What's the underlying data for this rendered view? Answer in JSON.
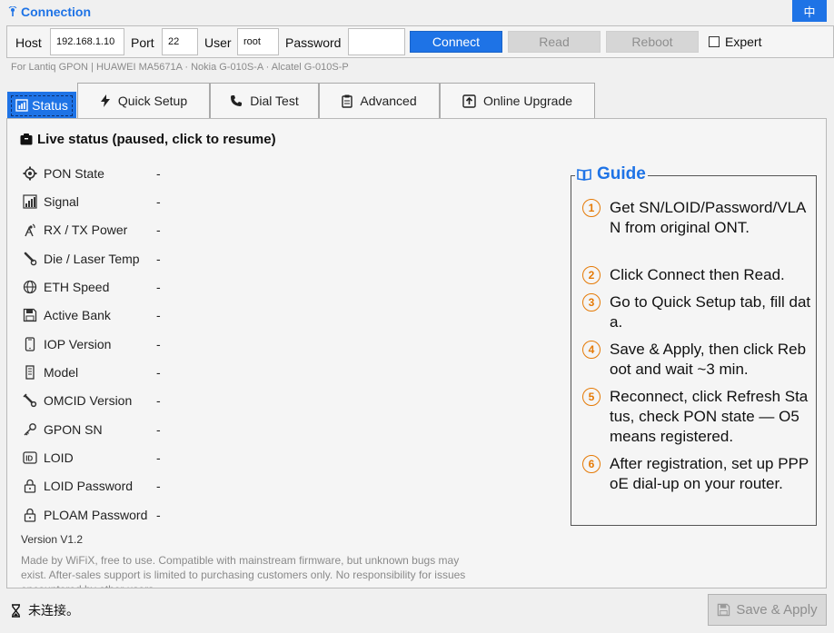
{
  "connection": {
    "title": "Connection",
    "lang_button": "中",
    "host_label": "Host",
    "host_value": "192.168.1.10",
    "port_label": "Port",
    "port_value": "22",
    "user_label": "User",
    "user_value": "root",
    "password_label": "Password",
    "password_value": "",
    "connect_label": "Connect",
    "read_label": "Read",
    "reboot_label": "Reboot",
    "expert_label": "Expert",
    "expert_checked": false,
    "hint": "For Lantiq GPON | HUAWEI MA5671A · Nokia G-010S-A · Alcatel G-010S-P"
  },
  "tabs": [
    {
      "label": "Status",
      "icon": "status-icon",
      "active": true
    },
    {
      "label": "Quick Setup",
      "icon": "lightning-icon"
    },
    {
      "label": "Dial Test",
      "icon": "phone-icon"
    },
    {
      "label": "Advanced",
      "icon": "clipboard-icon"
    },
    {
      "label": "Online Upgrade",
      "icon": "upload-icon"
    }
  ],
  "status": {
    "live_label": "Live status (paused, click to resume)",
    "items": [
      {
        "label": "PON State",
        "value": "-",
        "icon": "gear-icon"
      },
      {
        "label": "Signal",
        "value": "-",
        "icon": "signal-icon"
      },
      {
        "label": "RX / TX Power",
        "value": "-",
        "icon": "antenna-icon"
      },
      {
        "label": "Die / Laser Temp",
        "value": "-",
        "icon": "thermometer-icon"
      },
      {
        "label": "ETH Speed",
        "value": "-",
        "icon": "globe-icon"
      },
      {
        "label": "Active Bank",
        "value": "-",
        "icon": "floppy-icon"
      },
      {
        "label": "IOP Version",
        "value": "-",
        "icon": "phone-device-icon"
      },
      {
        "label": "Model",
        "value": "-",
        "icon": "device-icon"
      },
      {
        "label": "OMCID Version",
        "value": "-",
        "icon": "wrench-icon"
      },
      {
        "label": "GPON SN",
        "value": "-",
        "icon": "key-icon"
      },
      {
        "label": "LOID",
        "value": "-",
        "icon": "id-icon"
      },
      {
        "label": "LOID Password",
        "value": "-",
        "icon": "lock-icon"
      },
      {
        "label": "PLOAM Password",
        "value": "-",
        "icon": "lock-icon"
      }
    ],
    "version": "Version V1.2",
    "made_by": "Made by WiFiX, free to use. Compatible with mainstream firmware, but unknown bugs may exist. After-sales support is limited to purchasing customers only. No responsibility for issues encountered by other users."
  },
  "guide": {
    "title": "Guide",
    "steps": [
      {
        "num": "1",
        "text": "Get SN/LOID/Password/VLAN from original ONT."
      },
      {
        "num": "2",
        "text": "Click Connect then Read."
      },
      {
        "num": "3",
        "text": "Go to Quick Setup tab, fill data."
      },
      {
        "num": "4",
        "text": "Save & Apply, then click Reboot and wait ~3 min."
      },
      {
        "num": "5",
        "text": "Reconnect, click Refresh Status, check PON state — O5 means registered."
      },
      {
        "num": "6",
        "text": "After registration, set up PPPoE dial-up on your router."
      }
    ]
  },
  "footer": {
    "status_text": "未连接。",
    "save_label": "Save & Apply"
  },
  "colors": {
    "accent": "#1e73e6",
    "step_orange": "#e57a06",
    "disabled_bg": "#d6d6d6"
  }
}
